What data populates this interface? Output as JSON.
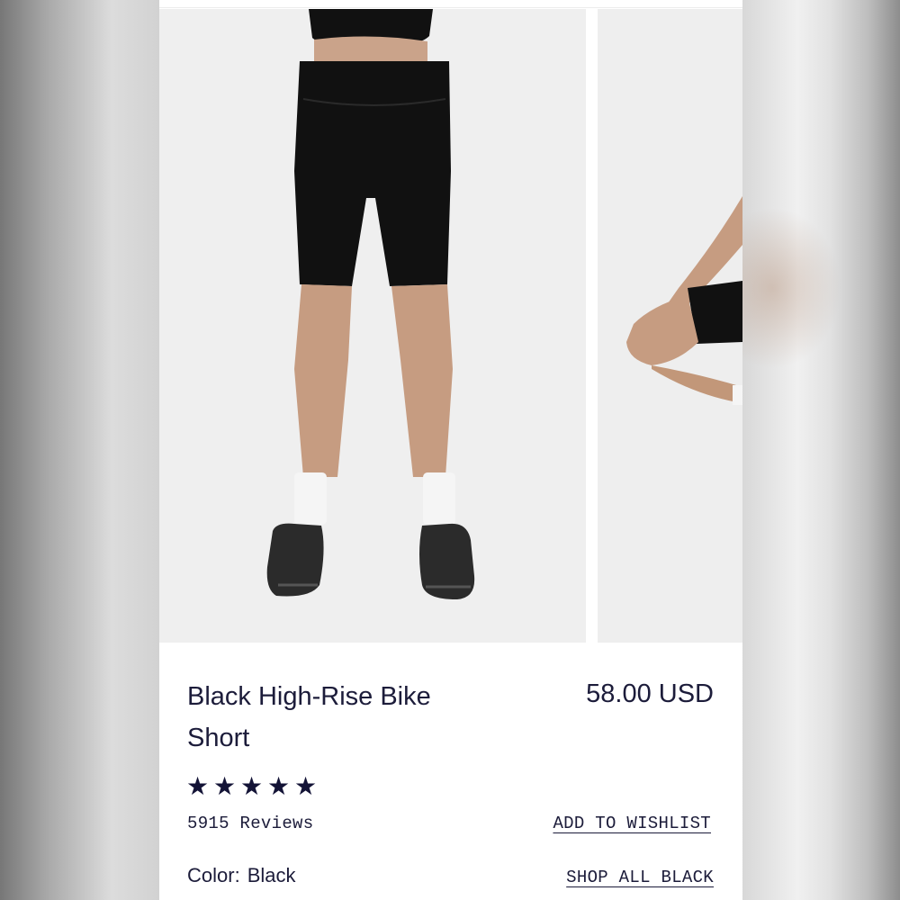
{
  "product": {
    "title": "Black High-Rise Bike Short",
    "price": "58.00 USD",
    "rating": 5,
    "rating_max": 5,
    "reviews_label": "5915 Reviews",
    "wishlist_label": "ADD TO WISHLIST",
    "color_label": "Color:",
    "color_value": "Black",
    "shop_color_label": "SHOP ALL BLACK"
  },
  "gallery": {
    "images": [
      "product-photo-front",
      "product-photo-side"
    ]
  },
  "colors": {
    "text": "#1c1c3a",
    "star": "#131336",
    "background": "#ffffff"
  }
}
